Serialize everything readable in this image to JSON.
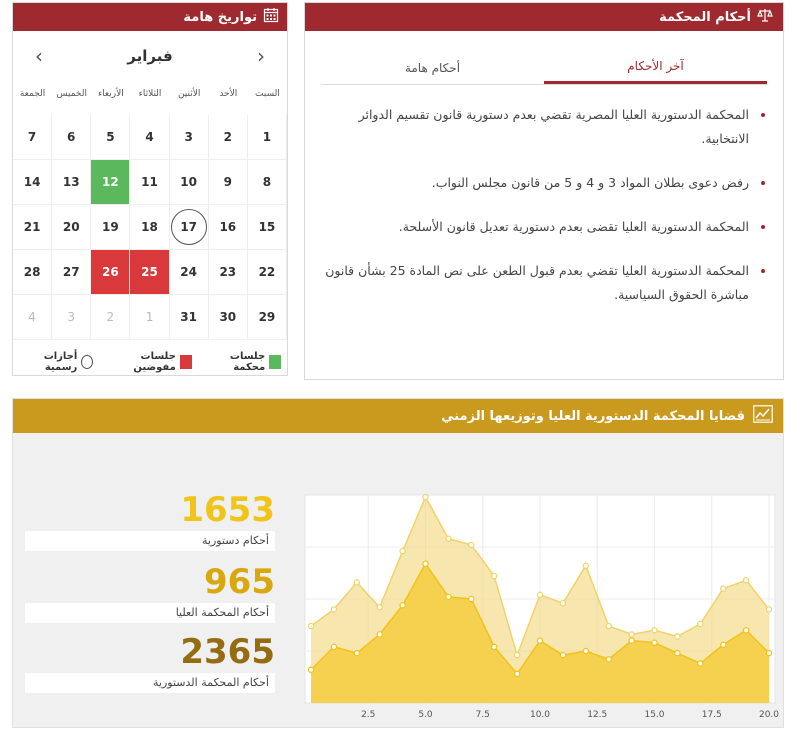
{
  "judgments": {
    "title": "أحكام المحكمة",
    "tabs": [
      "آخر الأحكام",
      "أحكام هامة"
    ],
    "items": [
      "المحكمة الدستورية العليا المصرية تقضي بعدم دستورية قانون تقسيم الدوائر الانتخابية.",
      "رفض دعوى بطلان المواد 3 و 4 و 5 من قانون مجلس النواب.",
      "المحكمة الدستورية العليا تقضى بعدم دستورية تعديل قانون الأسلحة.",
      "المحكمة الدستورية العليا تقضي بعدم قبول الطعن على نص المادة 25 بشأن قانون مباشرة الحقوق السياسية."
    ]
  },
  "calendar": {
    "title": "تواريخ هامة",
    "month": "فبراير",
    "prev_arrow": "‹",
    "next_arrow": "›",
    "weekdays": [
      "السبت",
      "الأحد",
      "الأثنين",
      "الثلاثاء",
      "الأربعاء",
      "الخميس",
      "الجمعة"
    ],
    "weeks": [
      [
        "1",
        "2",
        "3",
        "4",
        "5",
        "6",
        "7"
      ],
      [
        "8",
        "9",
        "10",
        "11",
        "12",
        "13",
        "14"
      ],
      [
        "15",
        "16",
        "17",
        "18",
        "19",
        "20",
        "21"
      ],
      [
        "22",
        "23",
        "24",
        "25",
        "26",
        "27",
        "28"
      ],
      [
        "29",
        "30",
        "31",
        "1",
        "2",
        "3",
        "4"
      ]
    ],
    "highlights": {
      "green": [
        "12"
      ],
      "red": [
        "25",
        "26"
      ],
      "ring": [
        "17"
      ]
    },
    "legend": [
      "جلسات محكمة",
      "جلسات مفوضين",
      "أجازات رسمية"
    ],
    "colors": {
      "green": "#5cb85c",
      "red": "#d9393b",
      "header": "#9e2a2f"
    }
  },
  "stats": {
    "title": "قضايا المحكمة الدستورية العليا وتوزيعها الزمني",
    "items": [
      {
        "value": "1653",
        "label": "أحكام دستورية",
        "color": "#f0c419"
      },
      {
        "value": "965",
        "label": "أحكام المحكمة العليا",
        "color": "#d9a80e"
      },
      {
        "value": "2365",
        "label": "أحكام المحكمة الدستورية",
        "color": "#946c12"
      }
    ],
    "header_color": "#c99a1e"
  },
  "chart_data": {
    "type": "area",
    "x_ticks": [
      "2.5",
      "5.0",
      "7.5",
      "10.0",
      "12.5",
      "15.0",
      "17.5",
      "20.0"
    ],
    "x": [
      0,
      1,
      2,
      3,
      4,
      5,
      6,
      7,
      8,
      9,
      10,
      11,
      12,
      13,
      14,
      15,
      16,
      17,
      18,
      19,
      20
    ],
    "xlim": [
      0,
      20
    ],
    "ylim": [
      0,
      100
    ],
    "grid": true,
    "series": [
      {
        "values": [
          37,
          45,
          58,
          46,
          73,
          99,
          79,
          76,
          61,
          23,
          52,
          48,
          66,
          37,
          33,
          35,
          32,
          38,
          55,
          59,
          45
        ],
        "color": "#f3dc8a"
      },
      {
        "values": [
          16,
          27,
          24,
          33,
          47,
          67,
          51,
          50,
          27,
          14,
          30,
          23,
          25,
          21,
          30,
          29,
          24,
          19,
          28,
          35,
          24
        ],
        "color": "#f5c930"
      }
    ]
  }
}
